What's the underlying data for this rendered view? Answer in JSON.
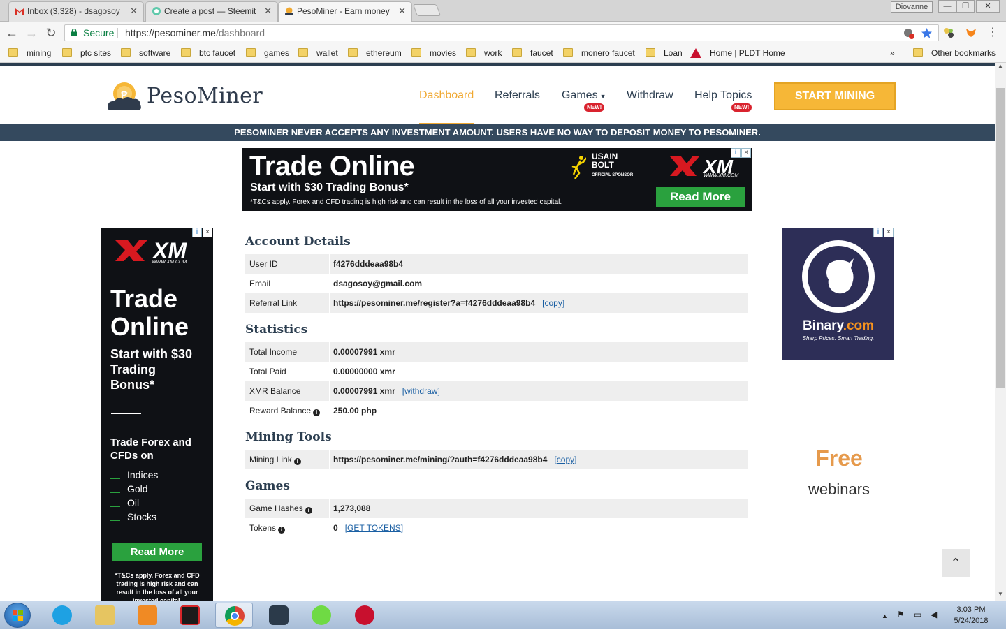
{
  "browser": {
    "tabs": [
      {
        "title": "Inbox (3,328) - dsagosoy"
      },
      {
        "title": "Create a post — Steemit"
      },
      {
        "title": "PesoMiner - Earn money"
      }
    ],
    "window_user": "Diovanne",
    "secure_label": "Secure",
    "url_host": "https://pesominer.me",
    "url_path": "/dashboard",
    "bookmarks": [
      "mining",
      "ptc sites",
      "software",
      "btc faucet",
      "games",
      "wallet",
      "ethereum",
      "movies",
      "work",
      "faucet",
      "monero faucet",
      "Loan",
      "Home | PLDT Home"
    ],
    "bookmarks_more": "»",
    "other_bookmarks": "Other bookmarks"
  },
  "site": {
    "logo_text": "PesoMiner",
    "nav": {
      "dashboard": "Dashboard",
      "referrals": "Referrals",
      "games": "Games",
      "withdraw": "Withdraw",
      "help": "Help Topics",
      "new_badge": "NEW!"
    },
    "start_button": "START MINING",
    "notice": "PESOMINER NEVER ACCEPTS ANY INVESTMENT AMOUNT. USERS HAVE NO WAY TO DEPOSIT MONEY TO PESOMINER."
  },
  "ads": {
    "top": {
      "headline": "Trade Online",
      "sub": "Start with $30 Trading Bonus*",
      "terms": "*T&Cs apply. Forex and CFD trading is high risk and can result in the loss of all your invested capital.",
      "sponsor_line1": "USAIN",
      "sponsor_line2": "BOLT",
      "sponsor_line3": "OFFICIAL SPONSOR",
      "xm_url": "WWW.XM.COM",
      "cta": "Read More"
    },
    "left": {
      "xm_url": "WWW.XM.COM",
      "headline": "Trade Online",
      "sub": "Start with $30 Trading Bonus*",
      "tf": "Trade Forex and CFDs on",
      "items": [
        "Indices",
        "Gold",
        "Oil",
        "Stocks"
      ],
      "cta": "Read More",
      "terms": "*T&Cs apply. Forex and CFD trading is high risk and can result in the loss of all your invested capital."
    },
    "right": {
      "brand_main": "Binary",
      "brand_suffix": ".com",
      "tagline": "Sharp Prices. Smart Trading."
    },
    "free": "Free",
    "webinars": "webinars",
    "adchoice": "i",
    "close": "×"
  },
  "account": {
    "title": "Account Details",
    "user_id_label": "User ID",
    "user_id": "f4276dddeaa98b4",
    "email_label": "Email",
    "email": "dsagosoy@gmail.com",
    "referral_label": "Referral Link",
    "referral_link": "https://pesominer.me/register?a=f4276dddeaa98b4",
    "copy": "copy"
  },
  "statistics": {
    "title": "Statistics",
    "total_income_label": "Total Income",
    "total_income": "0.00007991 xmr",
    "total_paid_label": "Total Paid",
    "total_paid": "0.00000000 xmr",
    "xmr_balance_label": "XMR Balance",
    "xmr_balance": "0.00007991 xmr",
    "withdraw": "withdraw",
    "reward_label": "Reward Balance",
    "reward": "250.00 php"
  },
  "mining_tools": {
    "title": "Mining Tools",
    "mining_link_label": "Mining Link",
    "mining_link": "https://pesominer.me/mining/?auth=f4276dddeaa98b4",
    "copy": "copy"
  },
  "games": {
    "title": "Games",
    "hashes_label": "Game Hashes",
    "hashes": "1,273,088",
    "tokens_label": "Tokens",
    "tokens": "0",
    "get_tokens": "GET TOKENS"
  },
  "taskbar": {
    "time": "3:03 PM",
    "date": "5/24/2018"
  }
}
